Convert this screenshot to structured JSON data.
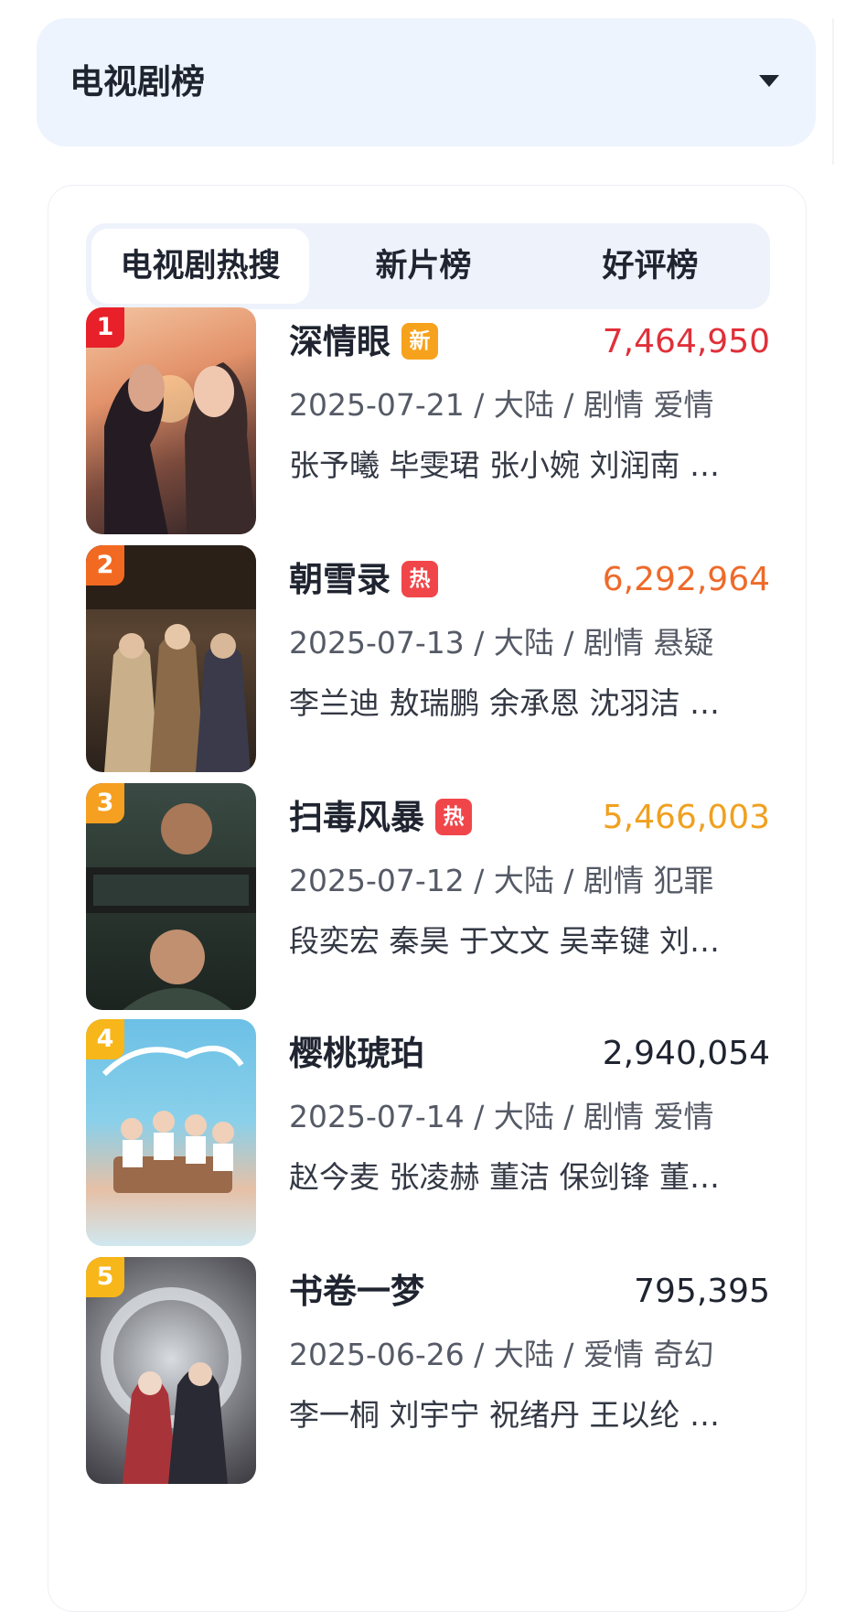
{
  "dropdown": {
    "title": "电视剧榜"
  },
  "tabs": [
    {
      "label": "电视剧热搜",
      "active": true
    },
    {
      "label": "新片榜",
      "active": false
    },
    {
      "label": "好评榜",
      "active": false
    }
  ],
  "colors": {
    "rank1": "#e8202a",
    "rank2": "#f26a22",
    "rank3": "#f6a021",
    "rank_other": "#f7b619",
    "score1": "#e0303a",
    "score2": "#ee6a2a",
    "score3": "#f0a020",
    "score_other": "#1f2430",
    "badge_new": "#f7a21c",
    "badge_hot": "#f0464a"
  },
  "items": [
    {
      "rank": "1",
      "title": "深情眼",
      "badge": "新",
      "score": "7,464,950",
      "meta": "2025-07-21 / 大陆 / 剧情 爱情",
      "cast": "张予曦 毕雯珺 张小婉 刘润南 …"
    },
    {
      "rank": "2",
      "title": "朝雪录",
      "badge": "热",
      "score": "6,292,964",
      "meta": "2025-07-13 / 大陆 / 剧情 悬疑",
      "cast": "李兰迪 敖瑞鹏 余承恩 沈羽洁 …"
    },
    {
      "rank": "3",
      "title": "扫毒风暴",
      "badge": "热",
      "score": "5,466,003",
      "meta": "2025-07-12 / 大陆 / 剧情 犯罪",
      "cast": "段奕宏 秦昊 于文文 吴幸键 刘…"
    },
    {
      "rank": "4",
      "title": "樱桃琥珀",
      "badge": "",
      "score": "2,940,054",
      "meta": "2025-07-14 / 大陆 / 剧情 爱情",
      "cast": "赵今麦 张凌赫 董洁 保剑锋 董…"
    },
    {
      "rank": "5",
      "title": "书卷一梦",
      "badge": "",
      "score": "795,395",
      "meta": "2025-06-26 / 大陆 / 爱情 奇幻",
      "cast": "李一桐 刘宇宁 祝绪丹 王以纶 …"
    }
  ]
}
